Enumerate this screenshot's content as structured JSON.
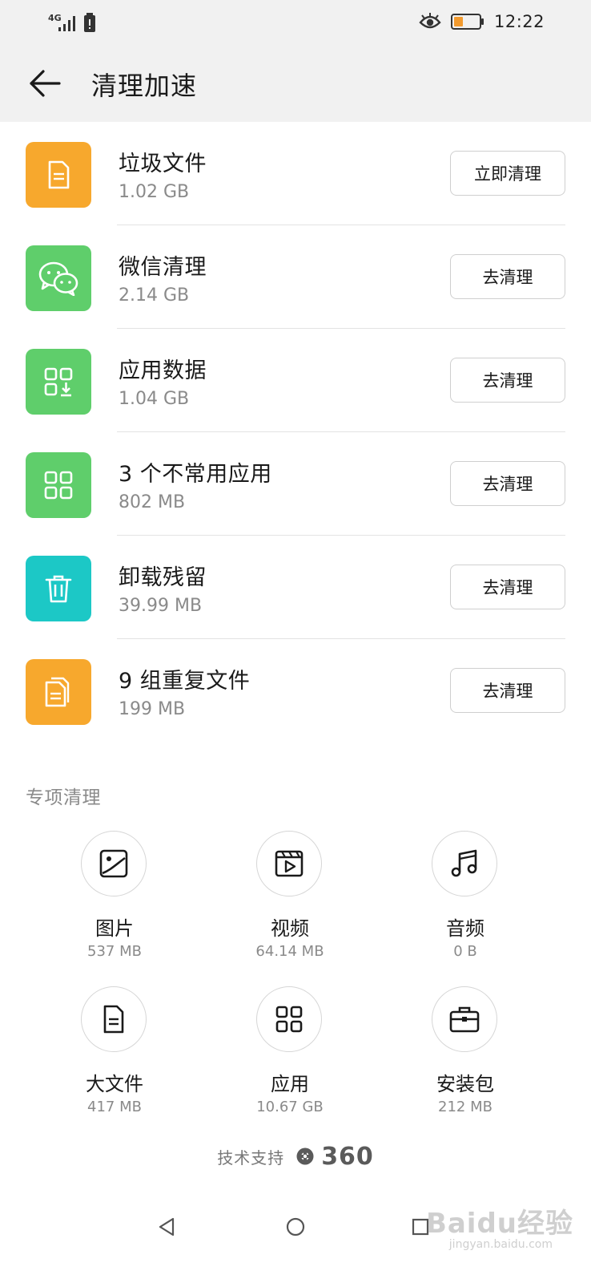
{
  "status_bar": {
    "network": "4G",
    "time": "12:22"
  },
  "header": {
    "title": "清理加速"
  },
  "clean_items": [
    {
      "title": "垃圾文件",
      "size": "1.02 GB",
      "button": "立即清理",
      "icon": "document-icon",
      "color": "#F7A82D"
    },
    {
      "title": "微信清理",
      "size": "2.14 GB",
      "button": "去清理",
      "icon": "wechat-icon",
      "color": "#5FCE6B"
    },
    {
      "title": "应用数据",
      "size": "1.04 GB",
      "button": "去清理",
      "icon": "app-data-icon",
      "color": "#5FCE6B"
    },
    {
      "title": "3 个不常用应用",
      "size": "802 MB",
      "button": "去清理",
      "icon": "apps-grid-icon",
      "color": "#5FCE6B"
    },
    {
      "title": "卸载残留",
      "size": "39.99 MB",
      "button": "去清理",
      "icon": "trash-icon",
      "color": "#1CC8C6"
    },
    {
      "title": "9 组重复文件",
      "size": "199 MB",
      "button": "去清理",
      "icon": "duplicate-files-icon",
      "color": "#F7A82D"
    }
  ],
  "special": {
    "title": "专项清理",
    "items": [
      {
        "label": "图片",
        "size": "537 MB",
        "icon": "image-icon"
      },
      {
        "label": "视频",
        "size": "64.14 MB",
        "icon": "video-icon"
      },
      {
        "label": "音频",
        "size": "0 B",
        "icon": "music-icon"
      },
      {
        "label": "大文件",
        "size": "417 MB",
        "icon": "large-file-icon"
      },
      {
        "label": "应用",
        "size": "10.67 GB",
        "icon": "apps-icon"
      },
      {
        "label": "安装包",
        "size": "212 MB",
        "icon": "package-icon"
      }
    ]
  },
  "footer": {
    "support_text": "技术支持",
    "brand": "360"
  },
  "watermark": {
    "text": "Baidu经验",
    "sub": "jingyan.baidu.com"
  },
  "colors": {
    "orange": "#F7A82D",
    "green": "#5FCE6B",
    "teal": "#1CC8C6",
    "header_bg": "#F1F1F1",
    "battery_level": "#F29A2E"
  }
}
